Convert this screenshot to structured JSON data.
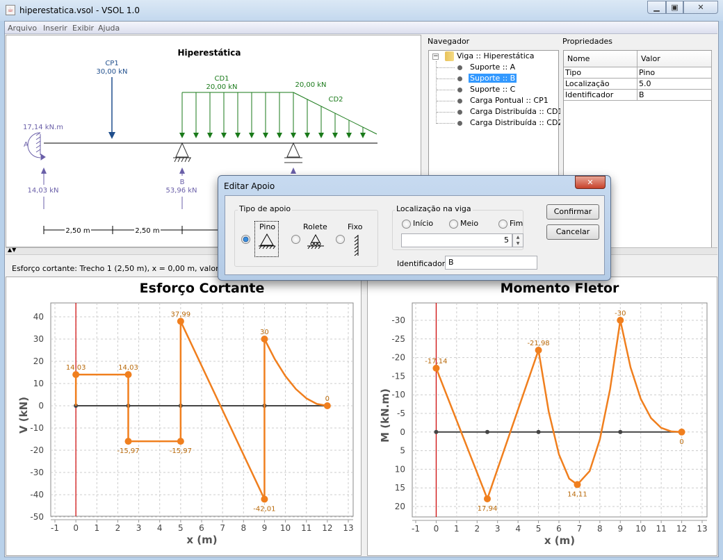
{
  "window": {
    "title": "hiperestatica.vsol - VSOL 1.0",
    "minimize": "minimize",
    "maximize": "maximize",
    "close": "close"
  },
  "menu": [
    "Arquivo",
    "Inserir",
    "Exibir",
    "Ajuda"
  ],
  "beam": {
    "title": "Hiperestática",
    "cp1": {
      "name": "CP1",
      "value": "30,00 kN"
    },
    "cd1": {
      "name": "CD1",
      "value": "20,00 kN"
    },
    "cd2": {
      "name": "CD2",
      "value": "20,00 kN"
    },
    "support_a": {
      "label": "A",
      "moment": "17,14 kN.m",
      "reaction": "14,03 kN"
    },
    "support_b": {
      "label": "B",
      "reaction": "53,96 kN"
    },
    "dims": [
      "2,50 m",
      "2,50 m"
    ],
    "colors": {
      "load_point": "#1f4e8c",
      "load_dist": "#1a7a1a",
      "reaction": "#6a5fa8"
    }
  },
  "navigator": {
    "label": "Navegador",
    "root": "Viga :: Hiperestática",
    "items": [
      "Suporte :: A",
      "Suporte :: B",
      "Suporte :: C",
      "Carga Pontual :: CP1",
      "Carga Distribuída :: CD1",
      "Carga Distribuída :: CD2"
    ],
    "selected_index": 1
  },
  "properties": {
    "label": "Propriedades",
    "headers": [
      "Nome",
      "Valor"
    ],
    "rows": [
      [
        "Tipo",
        "Pino"
      ],
      [
        "Localização",
        "5.0"
      ],
      [
        "Identificador",
        "B"
      ]
    ]
  },
  "status": "Esforço cortante:  Trecho 1 (2,50 m), x = 0,00 m, valor = 14",
  "dialog": {
    "title": "Editar Apoio",
    "tipo_label": "Tipo de apoio",
    "tipos": [
      "Pino",
      "Rolete",
      "Fixo"
    ],
    "tipo_selected": 0,
    "loc_label": "Localização na viga",
    "locs": [
      "Início",
      "Meio",
      "Fim"
    ],
    "loc_value": "5",
    "id_label": "Identificador:",
    "id_value": "B",
    "confirm": "Confirmar",
    "cancel": "Cancelar"
  },
  "chart_data": [
    {
      "type": "line",
      "title": "Esforço Cortante",
      "xlabel": "x (m)",
      "ylabel": "V (kN)",
      "xlim": [
        -1,
        13
      ],
      "ylim": [
        -50,
        46
      ],
      "inverted_y": false,
      "grid": true,
      "xticks": [
        -1,
        0,
        1,
        2,
        3,
        4,
        5,
        6,
        7,
        8,
        9,
        10,
        11,
        12,
        13
      ],
      "yticks": [
        40,
        30,
        20,
        10,
        0,
        -10,
        -20,
        -30,
        -40,
        -50
      ],
      "series": [
        {
          "x": [
            0,
            0,
            2.5,
            2.5,
            5,
            5,
            9,
            9,
            9.5,
            10,
            10.5,
            11,
            11.5,
            12
          ],
          "y": [
            0,
            14.03,
            14.03,
            -15.97,
            -15.97,
            37.99,
            -42.01,
            30,
            20.83,
            13.33,
            7.5,
            3.33,
            0.83,
            0
          ]
        }
      ],
      "markers": [
        {
          "x": 0,
          "y": 14.03,
          "label": "14,03"
        },
        {
          "x": 2.5,
          "y": 14.03,
          "label": "14,03"
        },
        {
          "x": 2.5,
          "y": -15.97,
          "label": "-15,97"
        },
        {
          "x": 5,
          "y": -15.97,
          "label": "-15,97"
        },
        {
          "x": 5,
          "y": 37.99,
          "label": "37,99"
        },
        {
          "x": 9,
          "y": -42.01,
          "label": "-42,01"
        },
        {
          "x": 9,
          "y": 30,
          "label": "30"
        },
        {
          "x": 12,
          "y": 0,
          "label": "0"
        }
      ],
      "nodes": [
        0,
        2.5,
        5,
        9,
        12
      ],
      "colors": {
        "line": "#f07f1e",
        "label": "#b8690a",
        "axis": "#444444",
        "cursor": "#cc0000"
      }
    },
    {
      "type": "line",
      "title": "Momento Fletor",
      "xlabel": "x (m)",
      "ylabel": "M (kN.m)",
      "xlim": [
        -1,
        13
      ],
      "ylim": [
        -34.7,
        22.8
      ],
      "inverted_y": true,
      "grid": true,
      "xticks": [
        -1,
        0,
        1,
        2,
        3,
        4,
        5,
        6,
        7,
        8,
        9,
        10,
        11,
        12,
        13
      ],
      "yticks": [
        -30,
        -25,
        -20,
        -15,
        -10,
        -5,
        0,
        5,
        10,
        15,
        20
      ],
      "series": [
        {
          "x": [
            0,
            2.5,
            5,
            5.5,
            6,
            6.5,
            6.9,
            7.5,
            8,
            8.5,
            9,
            9.5,
            10,
            10.5,
            11,
            11.5,
            12
          ],
          "y": [
            -17.14,
            17.94,
            -21.98,
            -5.49,
            6.01,
            12.51,
            14.11,
            10.5,
            1.99,
            -11.51,
            -30,
            -17.36,
            -8.89,
            -3.75,
            -1.11,
            -0.14,
            0
          ]
        }
      ],
      "markers": [
        {
          "x": 0,
          "y": -17.14,
          "label": "-17,14"
        },
        {
          "x": 2.5,
          "y": 17.94,
          "label": "17,94"
        },
        {
          "x": 5,
          "y": -21.98,
          "label": "-21,98"
        },
        {
          "x": 6.9,
          "y": 14.11,
          "label": "14,11"
        },
        {
          "x": 9,
          "y": -30,
          "label": "-30"
        },
        {
          "x": 12,
          "y": 0,
          "label": "0"
        }
      ],
      "nodes": [
        0,
        2.5,
        5,
        9,
        12
      ],
      "colors": {
        "line": "#f07f1e",
        "label": "#b8690a",
        "axis": "#444444",
        "cursor": "#cc0000"
      }
    }
  ]
}
